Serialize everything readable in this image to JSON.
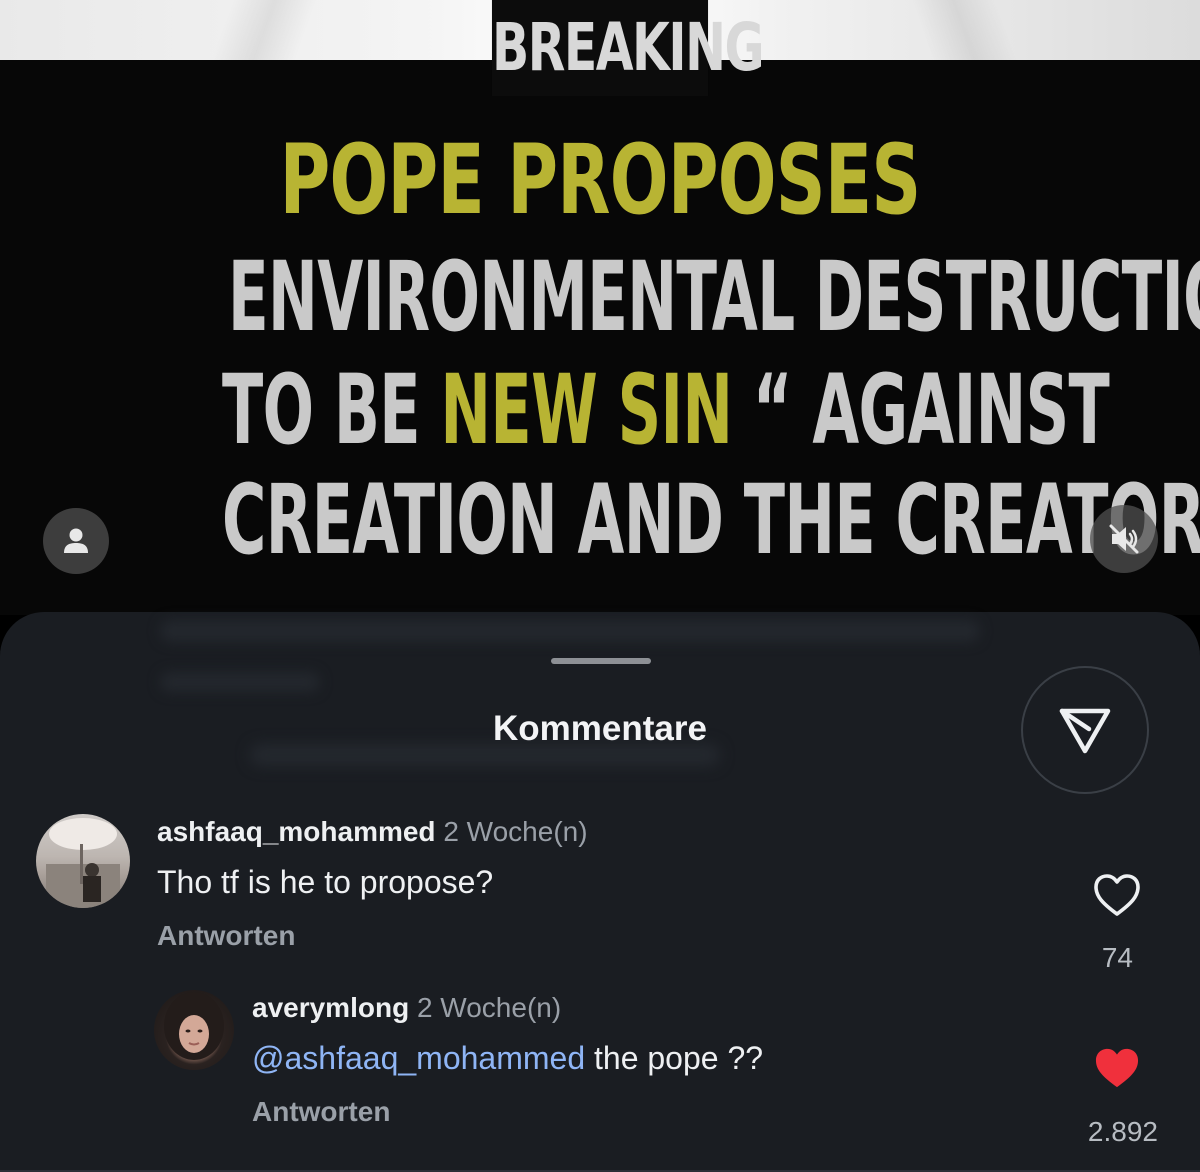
{
  "media": {
    "label": "BREAKING",
    "headline": {
      "line1": "POPE PROPOSES",
      "line2": "ENVIRONMENTAL DESTRUCTION",
      "line3_a": "TO BE ",
      "line3_b": "NEW SIN",
      "line3_c": " “ AGAINST",
      "line4": "CREATION AND THE CREATOR”"
    },
    "colors": {
      "accent": "#b8b433",
      "text": "#c9c9c9",
      "background": "#070707"
    },
    "icons": {
      "left": "person-icon",
      "right": "muted-speaker-icon"
    }
  },
  "comments_sheet": {
    "title": "Kommentare",
    "share_icon": "send-icon",
    "comments": [
      {
        "username": "ashfaaq_mohammed",
        "time": "2 Woche(n)",
        "text": "Tho tf is he to propose?",
        "reply_label": "Antworten",
        "likes": "74",
        "liked": false
      },
      {
        "username": "averymlong",
        "time": "2 Woche(n)",
        "mention": "@ashfaaq_mohammed",
        "text": " the pope ??",
        "reply_label": "Antworten",
        "likes": "2.892",
        "liked": true
      }
    ],
    "colors": {
      "sheet": "#1a1d22",
      "like_red": "#f0303c",
      "mention_blue": "#8fb5f5"
    }
  }
}
